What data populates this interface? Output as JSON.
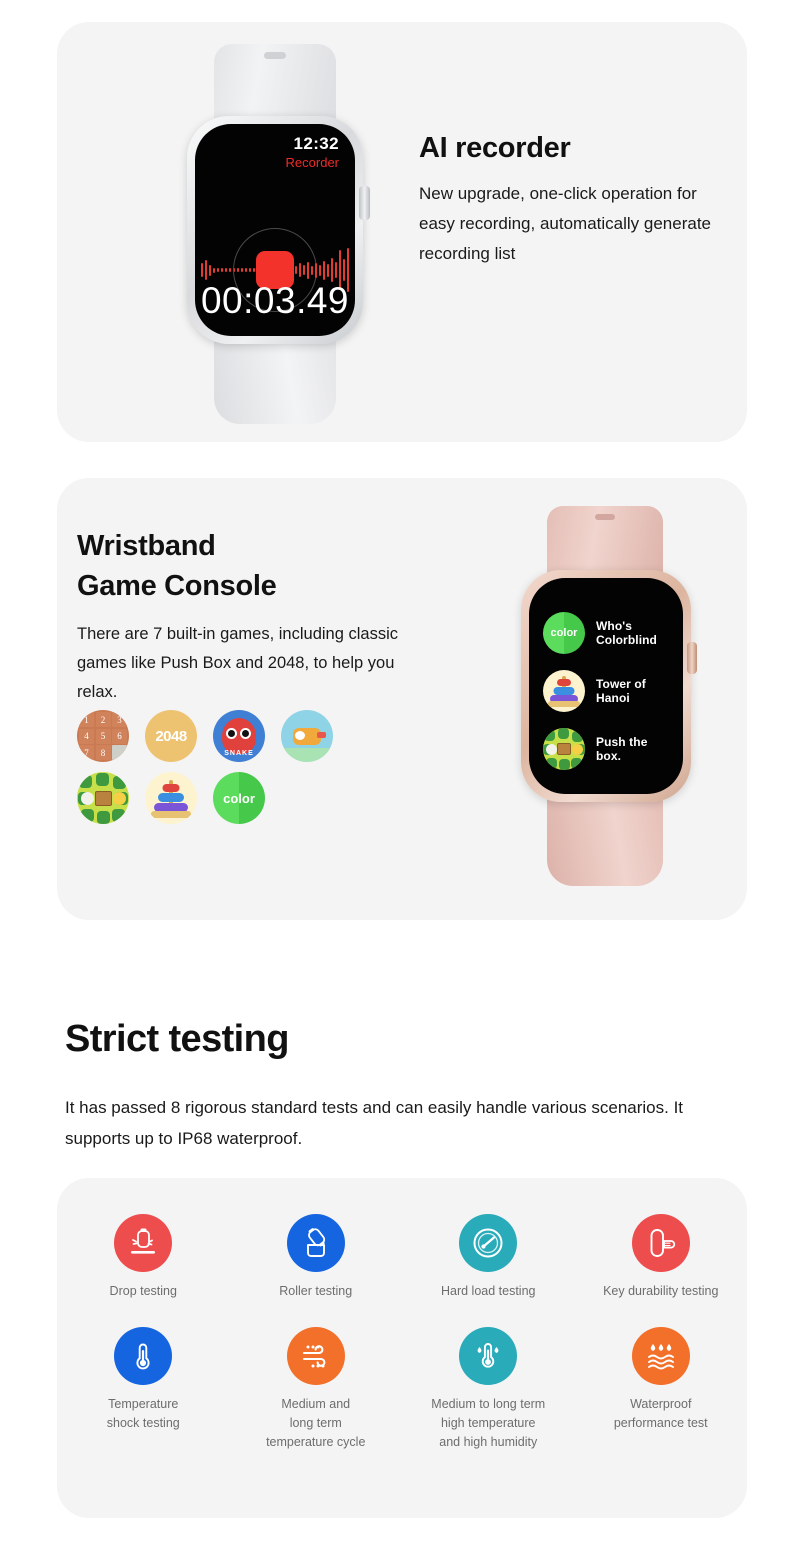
{
  "page": {
    "background": "#ffffff",
    "card_background": "#f4f4f4"
  },
  "recorder_card": {
    "title": "AI recorder",
    "description": "New upgrade, one-click operation for easy recording, automatically generate recording list",
    "watch": {
      "band_color": "#e3e4e6",
      "screen": {
        "time": "12:32",
        "app_label": "Recorder",
        "app_label_color": "#ef2b28",
        "timer": "00:03.49",
        "stop_button_color": "#f3322c",
        "waveform_color": "#e23c31"
      }
    }
  },
  "games_card": {
    "title_line1": "Wristband",
    "title_line2": "Game Console",
    "description": "There are 7 built-in games, including classic games like Push Box and 2048, to help you relax.",
    "game_count": 7,
    "game_icons": [
      {
        "name": "sliding-puzzle",
        "label": "",
        "tiles": [
          "1",
          "2",
          "3",
          "4",
          "5",
          "6",
          "7",
          "8",
          ""
        ],
        "color": "#c97a52"
      },
      {
        "name": "2048",
        "label": "2048",
        "color": "#edc372"
      },
      {
        "name": "snake",
        "label": "SNAKE",
        "color": "#3f7fd4"
      },
      {
        "name": "flappy-bird",
        "label": "",
        "color": "#8fd3e6"
      },
      {
        "name": "push-box",
        "label": "",
        "color": "#c7e04a"
      },
      {
        "name": "tower-of-hanoi",
        "label": "",
        "color": "#fdf3cf"
      },
      {
        "name": "color",
        "label": "color",
        "color": "#5cdc5c"
      }
    ],
    "watch": {
      "band_color": "#e4beb6",
      "menu": [
        {
          "icon": "color",
          "name": "Who's Colorblind"
        },
        {
          "icon": "tower-of-hanoi",
          "name": "Tower of Hanoi"
        },
        {
          "icon": "push-box",
          "name": "Push the box."
        }
      ]
    }
  },
  "strict_testing": {
    "heading": "Strict testing",
    "description": "It has passed 8 rigorous standard tests and can easily handle various scenarios. It supports up to IP68 waterproof.",
    "tests": [
      {
        "label": "Drop testing",
        "icon": "drop-watch-icon",
        "color": "#ee4d4d"
      },
      {
        "label": "Roller testing",
        "icon": "roller-tumble-icon",
        "color": "#1565e0"
      },
      {
        "label": "Hard load testing",
        "icon": "gauge-icon",
        "color": "#2aabba"
      },
      {
        "label": "Key durability testing",
        "icon": "finger-press-icon",
        "color": "#ee4d4d"
      },
      {
        "label": "Temperature\nshock testing",
        "icon": "thermometer-icon",
        "color": "#1565e0"
      },
      {
        "label": "Medium and\nlong term\ntemperature cycle",
        "icon": "wind-icon",
        "color": "#f2702a"
      },
      {
        "label": "Medium to long term\nhigh temperature\nand high humidity",
        "icon": "thermometer-humidity-icon",
        "color": "#2aabba"
      },
      {
        "label": "Waterproof\nperformance test",
        "icon": "water-drops-waves-icon",
        "color": "#f2702a"
      }
    ]
  }
}
